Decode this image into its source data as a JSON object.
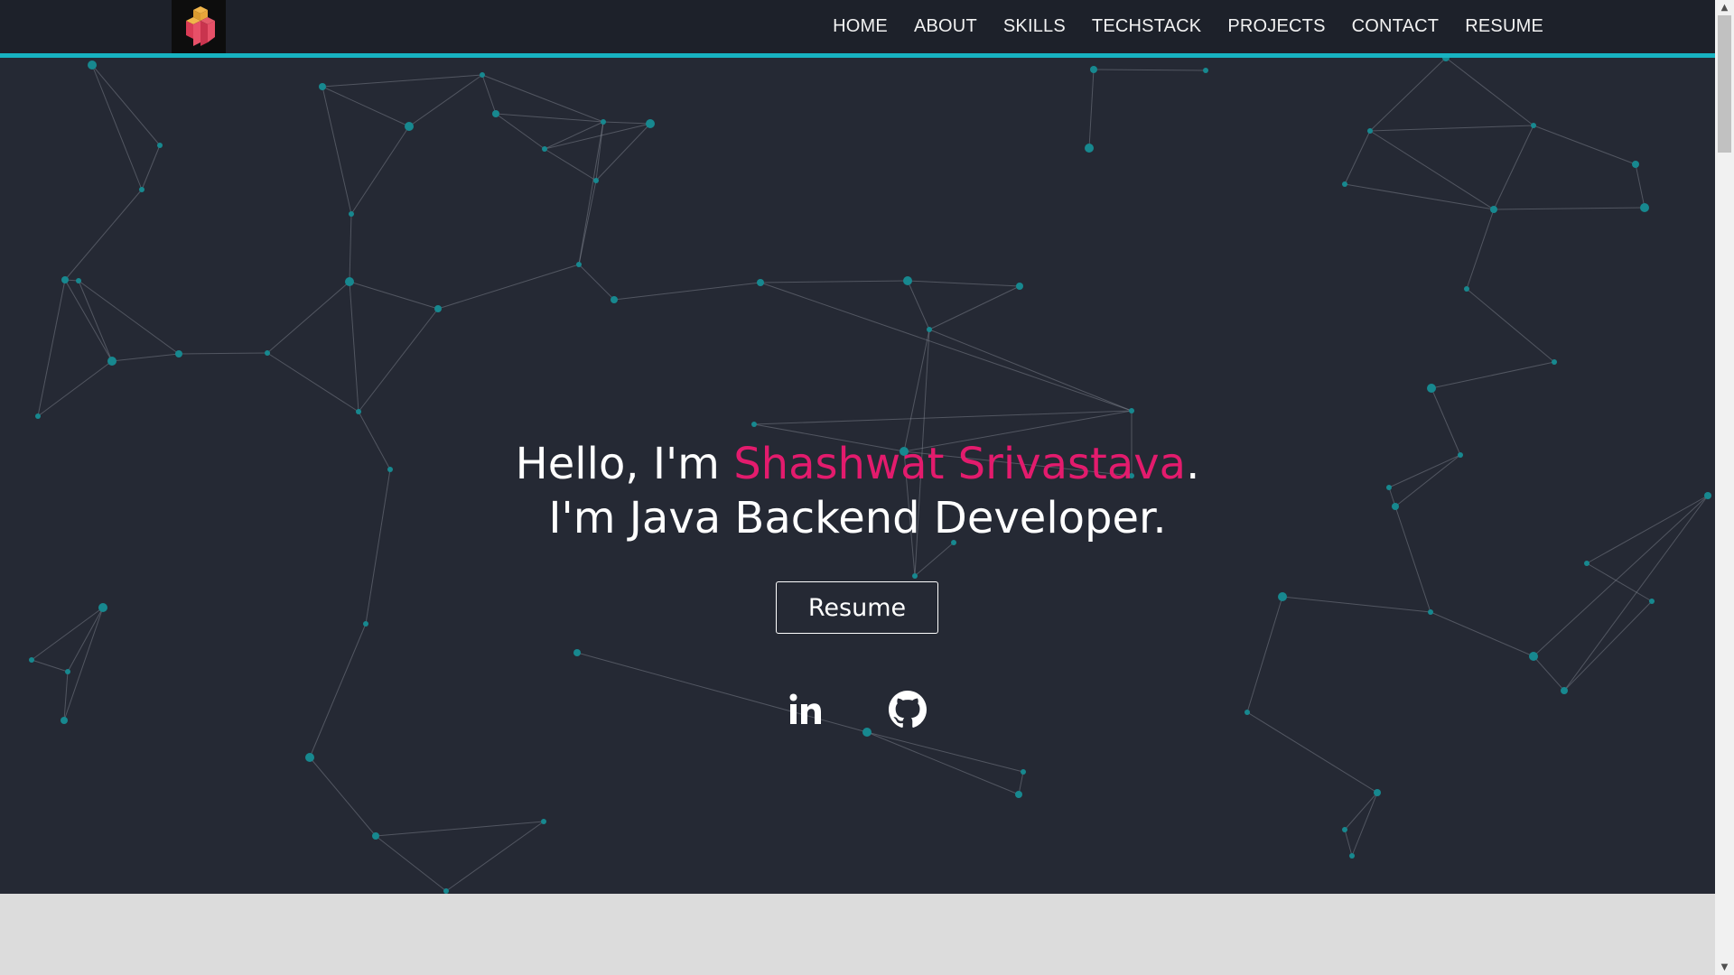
{
  "nav": {
    "logo_icon": "cubes-logo-icon",
    "links": [
      "HOME",
      "ABOUT",
      "SKILLS",
      "TECHSTACK",
      "PROJECTS",
      "CONTACT",
      "RESUME"
    ]
  },
  "hero": {
    "greeting_prefix": "Hello, I'm ",
    "name": "Shashwat Srivastava",
    "greeting_suffix": ".",
    "role_line": "I'm Java Backend Developer.",
    "resume_button": "Resume",
    "social_icons": [
      "linkedin-icon",
      "github-icon"
    ]
  },
  "colors": {
    "navbar_bg": "#1d212a",
    "navbar_border": "#17b3c1",
    "hero_bg": "#252934",
    "accent": "#e31b6d",
    "particle": "#17888f",
    "section_below_bg": "#dcdcdc"
  }
}
